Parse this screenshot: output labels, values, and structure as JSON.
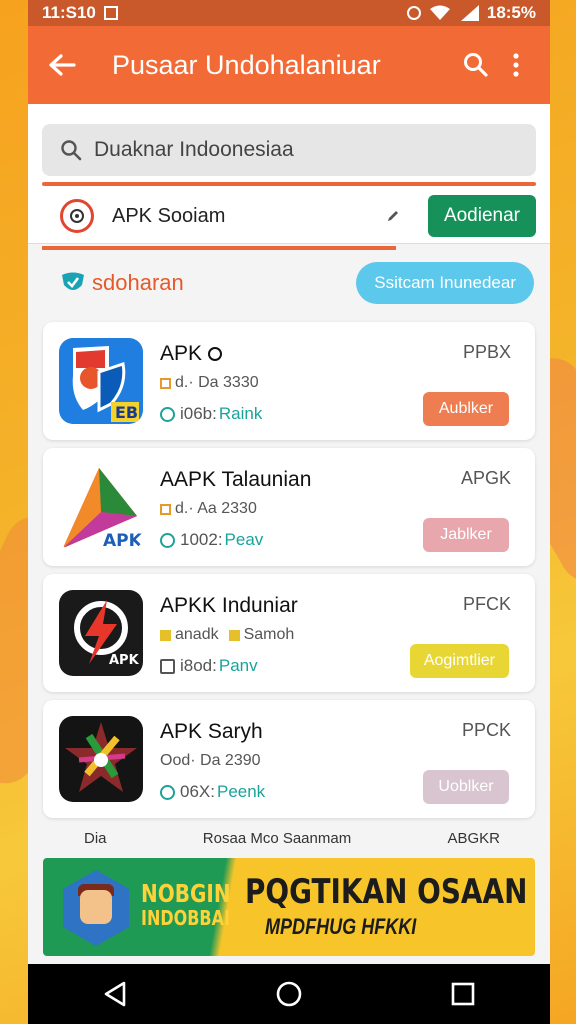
{
  "status": {
    "time": "11:S10",
    "battery": "18:5%"
  },
  "appbar": {
    "title": "Pusaar Undohalaniuar"
  },
  "search": {
    "value": "Duaknar Indoonesiaa"
  },
  "filter": {
    "label": "APK Sooiam",
    "button": "Aodienar"
  },
  "section": {
    "brand": "sdoharan",
    "pill": "Ssitcam Inunedear"
  },
  "apps": [
    {
      "name": "APK",
      "meta1": "d.· Da 3330",
      "meta2": "",
      "rank_num": "i06b:",
      "rank_label": "Raink",
      "size": "PPBX",
      "download": "Aublker",
      "download_color": "#ef7d52"
    },
    {
      "name": "AAPK Talaunian",
      "meta1": "d.· Aa 2330",
      "meta2": "",
      "rank_num": "1002:",
      "rank_label": "Peav",
      "size": "APGK",
      "download": "Jablker",
      "download_color": "#e8a7ac",
      "icon_text": "APK"
    },
    {
      "name": "APKK Induniar",
      "meta1": "anadk",
      "meta2": "Samoh",
      "rank_num": "i8od:",
      "rank_label": "Panv",
      "size": "PFCK",
      "download": "Aogimtlier",
      "download_color": "#e8d635",
      "icon_text": "APK"
    },
    {
      "name": "APK Saryh",
      "meta1": "Ood· Da 2390",
      "meta2": "",
      "rank_num": "06X:",
      "rank_label": "Peenk",
      "size": "PPCK",
      "download": "Uoblker",
      "download_color": "#d9c5cf"
    }
  ],
  "partial_row": {
    "left": "Dia",
    "middle": "Rosaa Mco Saanmam",
    "right": "ABGKR"
  },
  "banner": {
    "left_text_1": "NOBGIN",
    "left_text_2": "INDOBBAI",
    "headline": "PQGTIKAN OSAAN",
    "subline": "MPDFHUG HFKKI"
  },
  "colors": {
    "appbar": "#f26a36",
    "accent_green": "#17915a",
    "pill": "#5cc8ec"
  },
  "icons": [
    "back-arrow-icon",
    "search-icon",
    "more-vert-icon",
    "pencil-icon",
    "back-nav-icon",
    "home-nav-icon",
    "recents-nav-icon"
  ]
}
